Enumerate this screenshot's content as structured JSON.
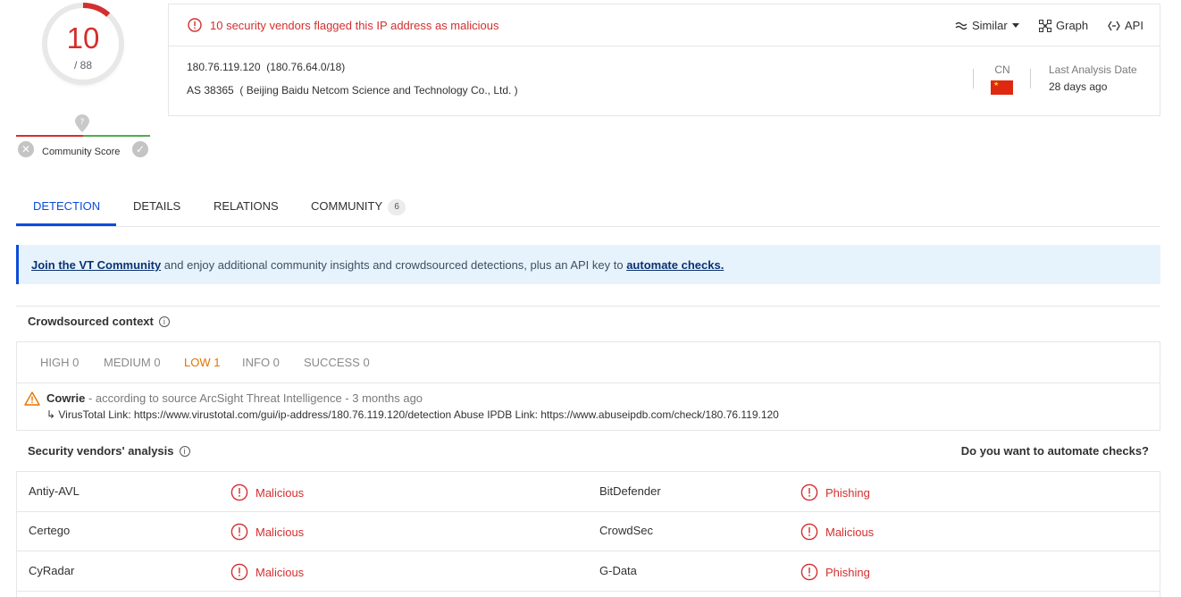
{
  "score": {
    "detections": "10",
    "total": "/ 88",
    "community_label": "Community Score",
    "detection_fraction": 0.114,
    "colors": {
      "malicious": "#d32f2f",
      "harmless": "#4caf50"
    }
  },
  "header": {
    "alert": "10 security vendors flagged this IP address as malicious",
    "actions": {
      "similar": "Similar",
      "graph": "Graph",
      "api": "API"
    },
    "ip": "180.76.119.120",
    "network": "(180.76.64.0/18)",
    "asn": "AS 38365",
    "as_owner": "( Beijing Baidu Netcom Science and Technology Co., Ltd. )",
    "country_code": "CN",
    "last_analysis_label": "Last Analysis Date",
    "last_analysis_value": "28 days ago"
  },
  "tabs": [
    {
      "label": "DETECTION",
      "active": true
    },
    {
      "label": "DETAILS"
    },
    {
      "label": "RELATIONS"
    },
    {
      "label": "COMMUNITY",
      "badge": "6"
    }
  ],
  "banner": {
    "link1": "Join the VT Community",
    "middle": " and enjoy additional community insights and crowdsourced detections, plus an API key to ",
    "link2": "automate checks."
  },
  "crowdsourced": {
    "title": "Crowdsourced context",
    "severities": [
      {
        "label": "HIGH 0"
      },
      {
        "label": "MEDIUM 0"
      },
      {
        "label": "LOW 1",
        "active": true
      },
      {
        "label": "INFO 0"
      },
      {
        "label": "SUCCESS 0"
      }
    ],
    "entry": {
      "name": "Cowrie",
      "source": " - according to source ArcSight Threat Intelligence - 3 months ago",
      "detail": "↳ VirusTotal Link: https://www.virustotal.com/gui/ip-address/180.76.119.120/detection Abuse IPDB Link: https://www.abuseipdb.com/check/180.76.119.120"
    }
  },
  "vendors": {
    "title": "Security vendors' analysis",
    "automate": "Do you want to automate checks?",
    "rows": [
      {
        "left_name": "Antiy-AVL",
        "left_result": "Malicious",
        "right_name": "BitDefender",
        "right_result": "Phishing"
      },
      {
        "left_name": "Certego",
        "left_result": "Malicious",
        "right_name": "CrowdSec",
        "right_result": "Malicious"
      },
      {
        "left_name": "CyRadar",
        "left_result": "Malicious",
        "right_name": "G-Data",
        "right_result": "Phishing"
      }
    ]
  }
}
